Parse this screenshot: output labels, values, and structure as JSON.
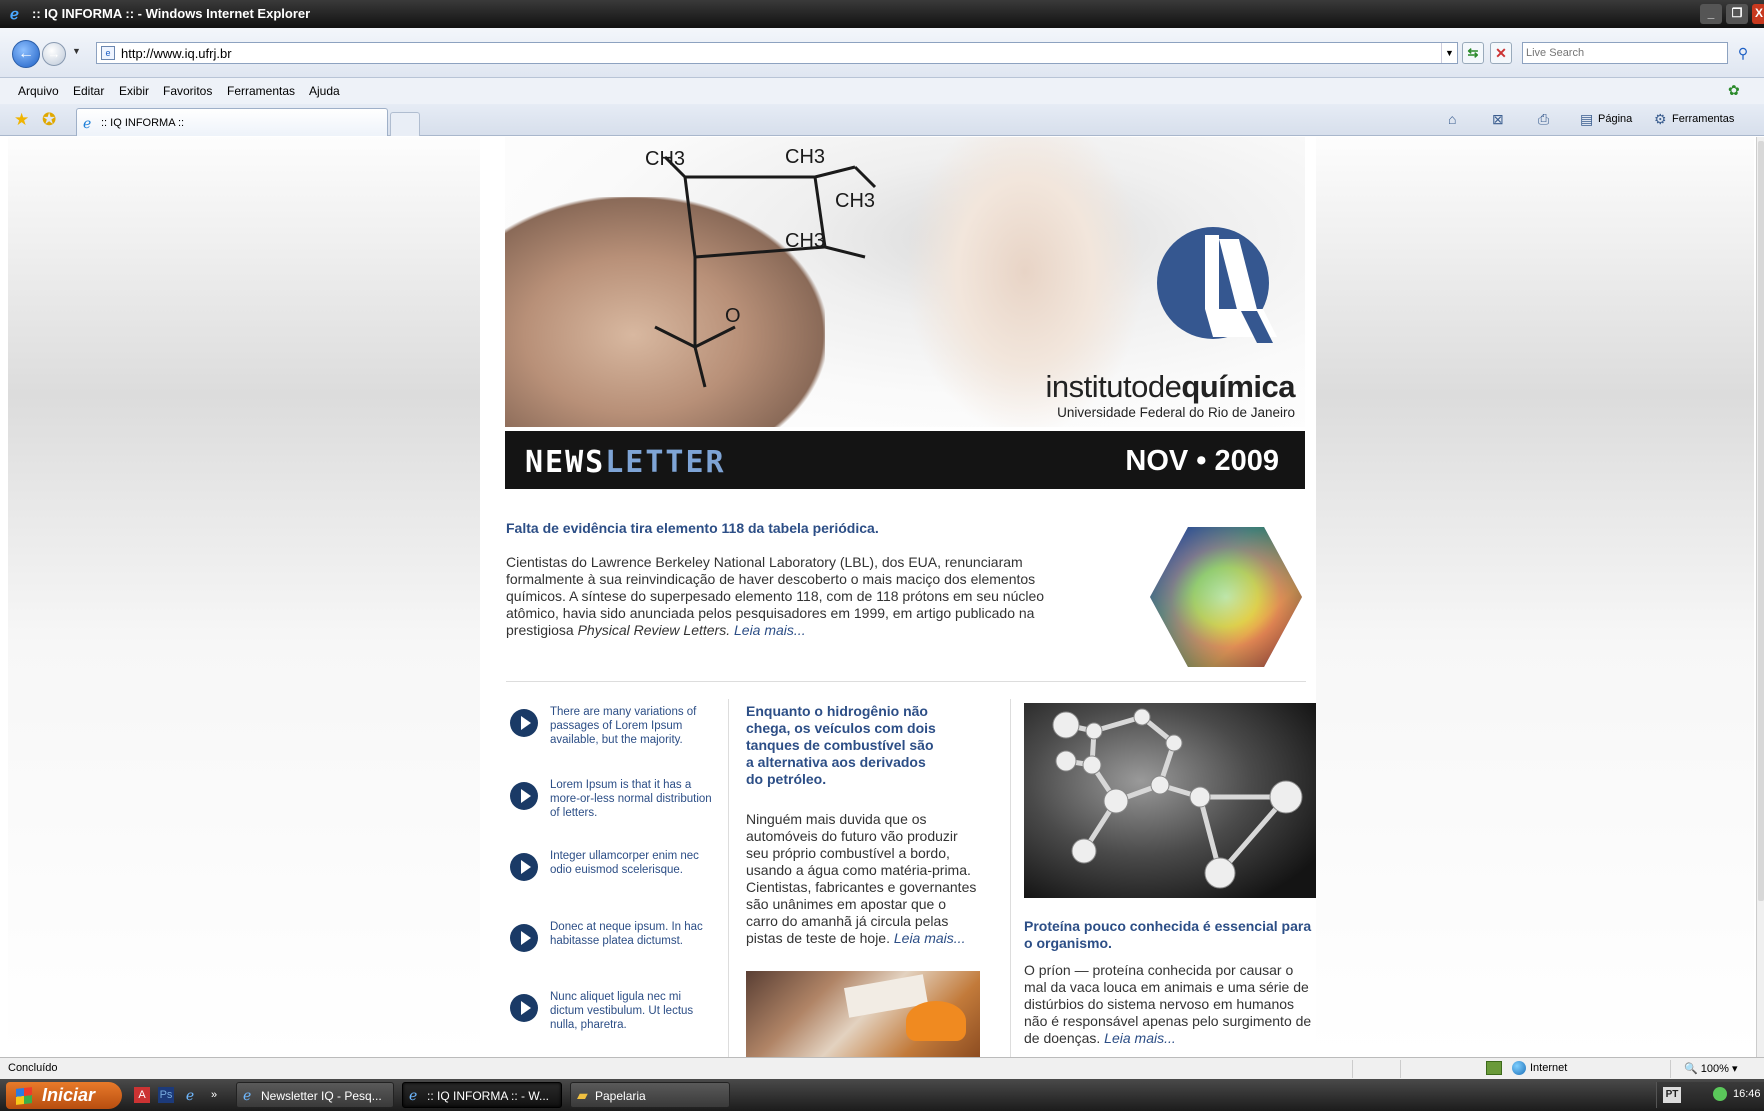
{
  "window": {
    "title": ":: IQ INFORMA :: - Windows Internet Explorer",
    "min": "_",
    "max": "❐",
    "close": "X"
  },
  "address": {
    "url": "http://www.iq.ufrj.br",
    "search_placeholder": "Live Search"
  },
  "menu": [
    "Arquivo",
    "Editar",
    "Exibir",
    "Favoritos",
    "Ferramentas",
    "Ajuda"
  ],
  "tab": {
    "label": ":: IQ INFORMA ::"
  },
  "commands": {
    "page": "Página",
    "tools": "Ferramentas"
  },
  "banner": {
    "wordmark_light": "institutode",
    "wordmark_bold": "química",
    "university": "Universidade Federal do Rio de Janeiro",
    "news_part1": "NEWS",
    "news_part2": "LETTER",
    "date": "NOV • 2009"
  },
  "lead": {
    "title": "Falta de evidência tira elemento 118 da tabela periódica.",
    "body": "Cientistas do Lawrence Berkeley National Laboratory (LBL), dos EUA, renunciaram formalmente à sua reinvindicação de haver descoberto o mais maciço dos elementos químicos. A síntese do superpesado elemento 118, com de 118 prótons em seu núcleo atômico, havia sido anunciada pelos pesquisadores em 1999, em artigo publicado na prestigiosa ",
    "journal": "Physical Review Letters.",
    "read_more": "Leia mais..."
  },
  "bullets": [
    "There are many variations of passages of Lorem Ipsum available, but the majority.",
    "Lorem Ipsum is that it has a more-or-less normal distribution of letters.",
    "Integer ullamcorper enim nec odio euismod scelerisque.",
    "Donec at neque ipsum. In hac habitasse platea dictumst.",
    "Nunc aliquet ligula nec mi dictum vestibulum. Ut lectus nulla, pharetra."
  ],
  "middle": {
    "title": "Enquanto o hidrogênio não chega, os veículos com dois tanques de combustível são a alternativa aos derivados do petróleo.",
    "body": "Ninguém mais duvida que os automóveis do futuro vão produzir seu próprio combustível a bordo, usando a água como matéria-prima. Cientistas, fabricantes e governantes são unânimes em apostar que o carro do amanhã já circula pelas pistas de teste de hoje. ",
    "read_more": "Leia mais..."
  },
  "right": {
    "title": "Proteína pouco conhecida é essencial para o organismo.",
    "body": "O príon — proteína conhecida por causar o mal da vaca louca em animais e uma série de distúrbios do sistema nervoso em humanos não é responsável apenas pelo surgimento de de doenças. ",
    "read_more": "Leia mais..."
  },
  "status": {
    "left": "Concluído",
    "zone": "Internet",
    "zoom": "100%"
  },
  "taskbar": {
    "start": "Iniciar",
    "tasks": [
      "Newsletter IQ - Pesq...",
      ":: IQ INFORMA :: - W...",
      "Papelaria"
    ],
    "lang": "PT",
    "clock": "16:46"
  },
  "colors": {
    "accent_blue": "#2c4e86",
    "news_light": "#7ea4d6",
    "start_orange": "#e87a2a"
  },
  "icons": [
    "ie-icon",
    "back-arrow-icon",
    "forward-arrow-icon",
    "page-icon",
    "refresh-icon",
    "stop-icon",
    "search-icon",
    "favorites-star-icon",
    "add-favorites-icon",
    "home-icon",
    "feeds-icon",
    "print-icon",
    "page-menu-icon",
    "tools-gear-icon",
    "globe-icon",
    "windows-flag-icon"
  ]
}
